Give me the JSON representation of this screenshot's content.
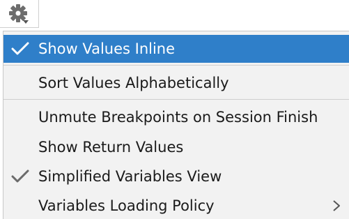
{
  "toolbar": {
    "settings_icon": "gear-icon",
    "dropdown_icon": "caret-down-icon"
  },
  "menu": {
    "items": [
      {
        "label": "Show Values Inline",
        "checked": true,
        "selected": true
      },
      {
        "label": "Sort Values Alphabetically",
        "checked": false,
        "selected": false
      },
      {
        "label": "Unmute Breakpoints on Session Finish",
        "checked": false,
        "selected": false
      },
      {
        "label": "Show Return Values",
        "checked": false,
        "selected": false
      },
      {
        "label": "Simplified Variables View",
        "checked": true,
        "selected": false
      },
      {
        "label": "Variables Loading Policy",
        "checked": false,
        "selected": false,
        "submenu": true
      }
    ]
  },
  "colors": {
    "selection": "#2f7fc9",
    "menu_background": "#f2f2f2",
    "text": "#1a1a1a",
    "check_unselected": "#6b6b6b"
  }
}
